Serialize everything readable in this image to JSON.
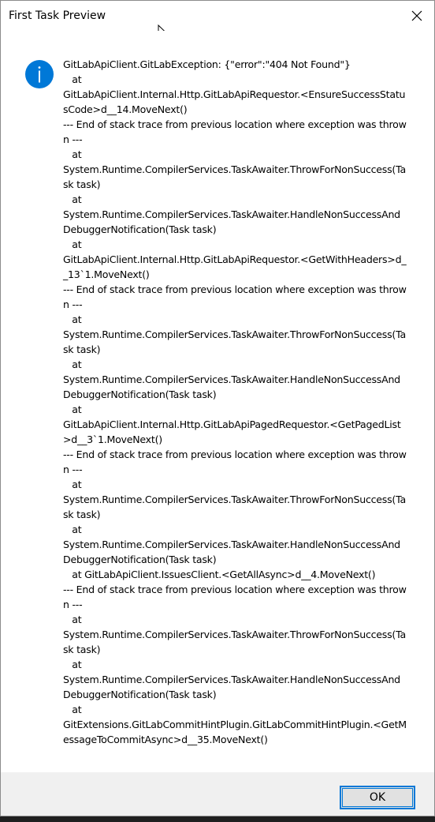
{
  "dialog": {
    "title": "First Task Preview",
    "icon": "info-icon",
    "message": "GitLabApiClient.GitLabException: {\"error\":\"404 Not Found\"}\n   at\nGitLabApiClient.Internal.Http.GitLabApiRequestor.<EnsureSuccessStatusCode>d__14.MoveNext()\n--- End of stack trace from previous location where exception was thrown ---\n   at\nSystem.Runtime.CompilerServices.TaskAwaiter.ThrowForNonSuccess(Task task)\n   at\nSystem.Runtime.CompilerServices.TaskAwaiter.HandleNonSuccessAndDebuggerNotification(Task task)\n   at\nGitLabApiClient.Internal.Http.GitLabApiRequestor.<GetWithHeaders>d__13`1.MoveNext()\n--- End of stack trace from previous location where exception was thrown ---\n   at\nSystem.Runtime.CompilerServices.TaskAwaiter.ThrowForNonSuccess(Task task)\n   at\nSystem.Runtime.CompilerServices.TaskAwaiter.HandleNonSuccessAndDebuggerNotification(Task task)\n   at\nGitLabApiClient.Internal.Http.GitLabApiPagedRequestor.<GetPagedList>d__3`1.MoveNext()\n--- End of stack trace from previous location where exception was thrown ---\n   at\nSystem.Runtime.CompilerServices.TaskAwaiter.ThrowForNonSuccess(Task task)\n   at\nSystem.Runtime.CompilerServices.TaskAwaiter.HandleNonSuccessAndDebuggerNotification(Task task)\n   at GitLabApiClient.IssuesClient.<GetAllAsync>d__4.MoveNext()\n--- End of stack trace from previous location where exception was thrown ---\n   at\nSystem.Runtime.CompilerServices.TaskAwaiter.ThrowForNonSuccess(Task task)\n   at\nSystem.Runtime.CompilerServices.TaskAwaiter.HandleNonSuccessAndDebuggerNotification(Task task)\n   at\nGitExtensions.GitLabCommitHintPlugin.GitLabCommitHintPlugin.<GetMessageToCommitAsync>d__35.MoveNext()",
    "ok_label": "OK"
  },
  "colors": {
    "accent": "#0078d7",
    "footer_bg": "#f0f0f0",
    "button_bg": "#e1e1e1"
  }
}
